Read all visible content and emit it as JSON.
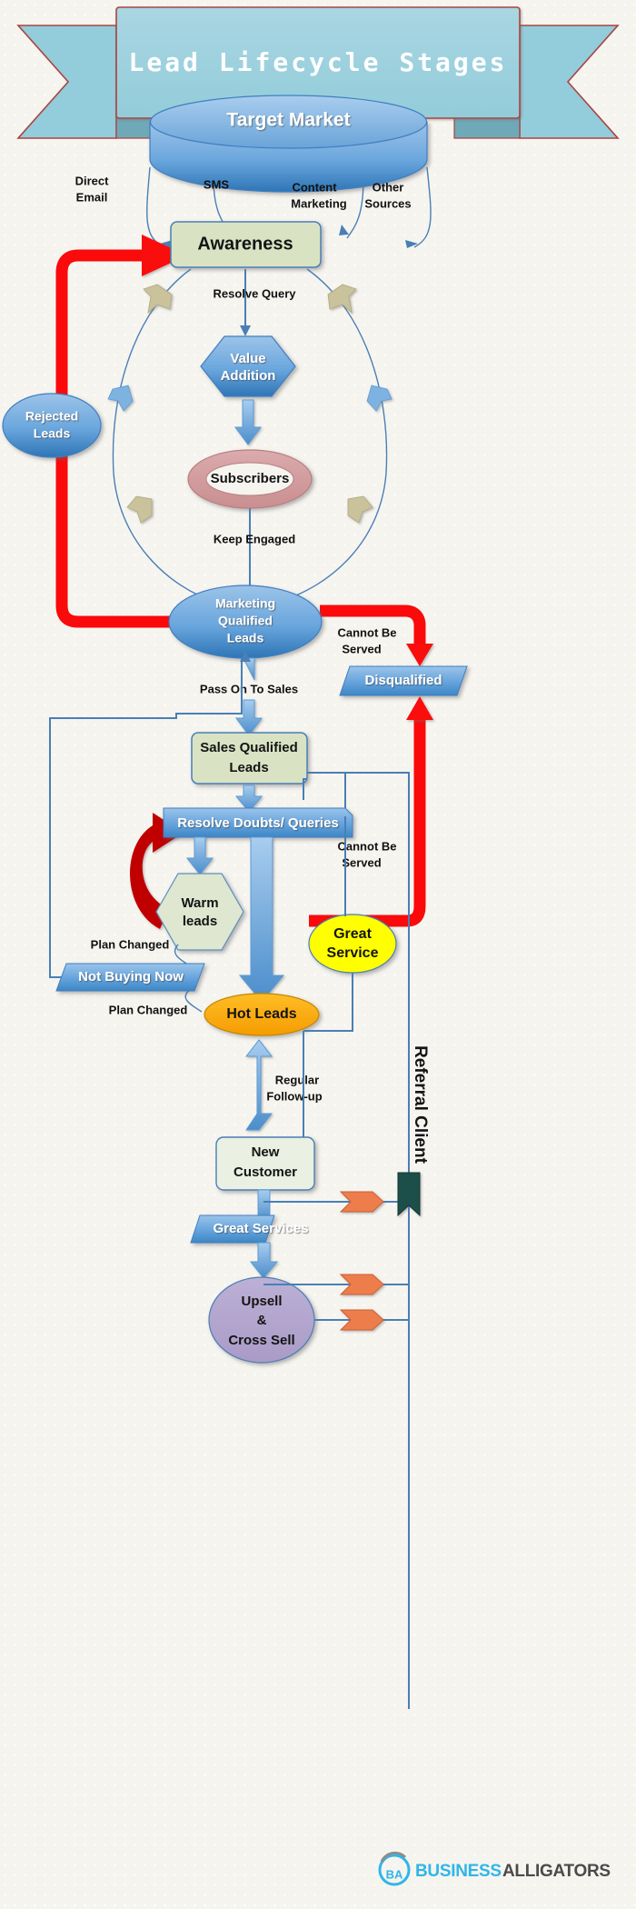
{
  "title_banner": {
    "text": "Lead Lifecycle Stages",
    "fill": "#9fd2e0",
    "stroke": "#a94442"
  },
  "nodes": {
    "target_market": {
      "label": "Target Market",
      "shape": "cylinder",
      "color": "#5b9bd5"
    },
    "awareness": {
      "label": "Awareness",
      "shape": "rounded-rect",
      "color": "#d9e3c4"
    },
    "value_addition": {
      "label_line1": "Value",
      "label_line2": "Addition",
      "shape": "hexagon",
      "color": "#5b9bd5"
    },
    "subscribers": {
      "label": "Subscribers",
      "shape": "donut",
      "color": "#d39a9c"
    },
    "rejected_leads": {
      "label_line1": "Rejected",
      "label_line2": "Leads",
      "shape": "ellipse",
      "color": "#5b9bd5"
    },
    "marketing_qualified_leads": {
      "label_line1": "Marketing",
      "label_line2": "Qualified",
      "label_line3": "Leads",
      "shape": "ellipse",
      "color": "#5b9bd5"
    },
    "disqualified": {
      "label": "Disqualified",
      "shape": "parallelogram",
      "color": "#5b9bd5"
    },
    "sales_qualified_leads": {
      "label_line1": "Sales Qualified",
      "label_line2": "Leads",
      "shape": "rounded-rect",
      "color": "#d9e3c4"
    },
    "resolve_doubts": {
      "label": "Resolve Doubts/ Queries",
      "shape": "bar",
      "color": "#5b9bd5"
    },
    "warm_leads": {
      "label_line1": "Warm",
      "label_line2": "leads",
      "shape": "hexagon",
      "color": "#dfe7d0"
    },
    "not_buying_now": {
      "label": "Not Buying Now",
      "shape": "parallelogram",
      "color": "#5b9bd5"
    },
    "hot_leads": {
      "label": "Hot Leads",
      "shape": "ellipse",
      "color": "#fdab09"
    },
    "great_service": {
      "label_line1": "Great",
      "label_line2": "Service",
      "shape": "ellipse",
      "color": "#ffff00"
    },
    "new_customer": {
      "label_line1": "New",
      "label_line2": "Customer",
      "shape": "rounded-rect",
      "color": "#eaf0e2"
    },
    "great_services": {
      "label": "Great Services",
      "shape": "parallelogram",
      "color": "#5b9bd5"
    },
    "upsell_cross_sell": {
      "label_line1": "Upsell",
      "label_line2": "&",
      "label_line3": "Cross Sell",
      "shape": "ellipse",
      "color": "#b3a6ce"
    }
  },
  "edge_labels": {
    "direct_email_l1": "Direct",
    "direct_email_l2": "Email",
    "sms": "SMS",
    "content_marketing_l1": "Content",
    "content_marketing_l2": "Marketing",
    "other_sources_l1": "Other",
    "other_sources_l2": "Sources",
    "resolve_query": "Resolve Query",
    "keep_engaged": "Keep Engaged",
    "cannot_be_served_mql_l1": "Cannot Be",
    "cannot_be_served_mql_l2": "Served",
    "pass_on_to_sales": "Pass On To Sales",
    "cannot_be_served_sql_l1": "Cannot Be",
    "cannot_be_served_sql_l2": "Served",
    "plan_changed_warm": "Plan Changed",
    "plan_changed_hot": "Plan Changed",
    "regular_follow_up_l1": "Regular",
    "regular_follow_up_l2": "Follow-up",
    "referral_client": "Referral Client"
  },
  "footer_logo": {
    "mark": "BA",
    "text_primary": "BUSINESS",
    "text_secondary": "ALLIGATORS"
  },
  "palette": {
    "background": "#f6f4ef",
    "blue": "#5b9bd5",
    "blue_dark": "#2e75b6",
    "blue_line": "#4a7fb5",
    "green": "#d9e3c4",
    "red": "#fa0a0a",
    "red_dark": "#c00000",
    "orange": "#fdab09",
    "orange_chevron": "#ed7d4b",
    "yellow": "#ffff00",
    "purple": "#b3a6ce",
    "rose": "#d39a9c",
    "teal": "#1b4f4a",
    "tan": "#c9c29a"
  }
}
